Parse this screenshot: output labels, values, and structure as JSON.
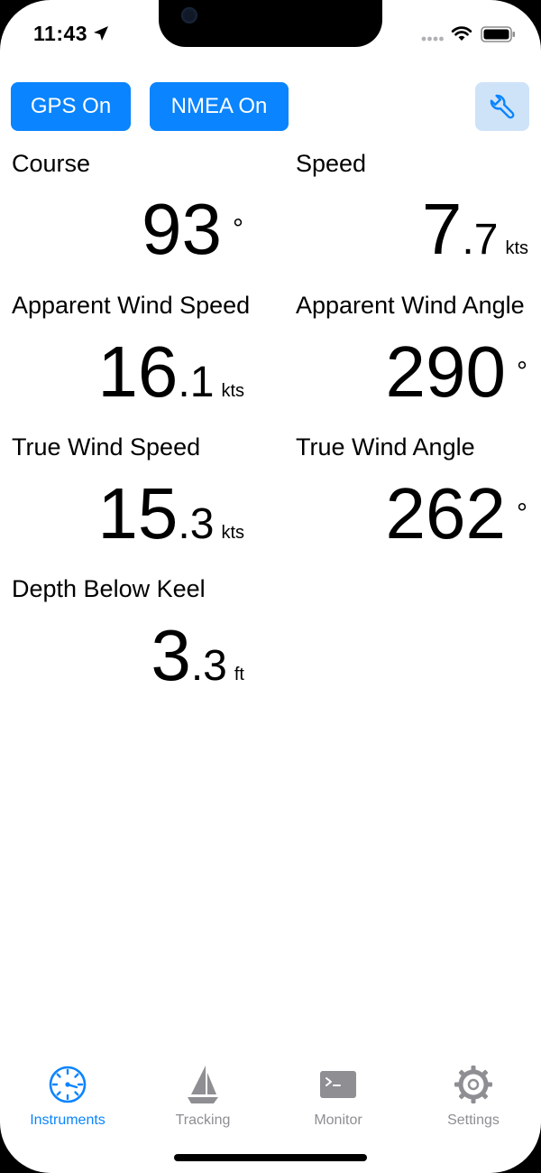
{
  "status_bar": {
    "time": "11:43"
  },
  "toolbar": {
    "gps_label": "GPS On",
    "nmea_label": "NMEA On"
  },
  "instruments": {
    "course": {
      "label": "Course",
      "int": "93",
      "dec": "",
      "unit": "°"
    },
    "speed": {
      "label": "Speed",
      "int": "7",
      "dec": ".7",
      "unit": "kts"
    },
    "apparent_wind_speed": {
      "label": "Apparent Wind Speed",
      "int": "16",
      "dec": ".1",
      "unit": "kts"
    },
    "apparent_wind_angle": {
      "label": "Apparent Wind Angle",
      "int": "290",
      "dec": "",
      "unit": "°"
    },
    "true_wind_speed": {
      "label": "True Wind Speed",
      "int": "15",
      "dec": ".3",
      "unit": "kts"
    },
    "true_wind_angle": {
      "label": "True Wind Angle",
      "int": "262",
      "dec": "",
      "unit": "°"
    },
    "depth_below_keel": {
      "label": "Depth Below Keel",
      "int": "3",
      "dec": ".3",
      "unit": "ft"
    }
  },
  "tabs": [
    {
      "label": "Instruments",
      "icon": "gauge-icon",
      "active": true
    },
    {
      "label": "Tracking",
      "icon": "sailboat-icon",
      "active": false
    },
    {
      "label": "Monitor",
      "icon": "terminal-icon",
      "active": false
    },
    {
      "label": "Settings",
      "icon": "gear-icon",
      "active": false
    }
  ],
  "colors": {
    "accent": "#0a84ff",
    "inactive": "#8e8e93",
    "button_light": "#cfe3f8"
  }
}
